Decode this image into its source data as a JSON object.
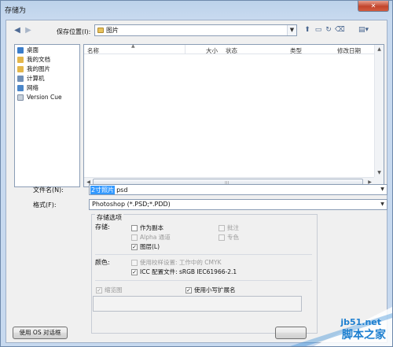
{
  "window": {
    "title": "存储为"
  },
  "toolbar": {
    "location_label": "保存位置(I):",
    "location_value": "图片"
  },
  "places": [
    {
      "label": "桌面",
      "icon": "desktop-icon",
      "color": "#3b7dc9"
    },
    {
      "label": "我的文档",
      "icon": "documents-icon",
      "color": "#e3b64a"
    },
    {
      "label": "我的图片",
      "icon": "pictures-icon",
      "color": "#e3b64a"
    },
    {
      "label": "计算机",
      "icon": "computer-icon",
      "color": "#6f8fb7"
    },
    {
      "label": "网络",
      "icon": "network-icon",
      "color": "#4a86c9"
    },
    {
      "label": "Version Cue",
      "icon": "version-cue-icon",
      "color": "#c8d1db"
    }
  ],
  "filelist": {
    "columns": [
      "名称",
      "大小",
      "状态",
      "类型",
      "修改日期"
    ]
  },
  "form": {
    "filename_label": "文件名(N):",
    "filename_selected": "2寸照片",
    "filename_rest": "psd",
    "format_label": "格式(F):",
    "format_value": "Photoshop (*.PSD;*.PDD)"
  },
  "options": {
    "title": "存储选项",
    "save_label": "存储:",
    "as_copy": "作为副本",
    "notes": "批注",
    "alpha": "Alpha 通道",
    "spot": "专色",
    "layers": "图层(L)",
    "color_label": "颜色:",
    "use_proof": "使用校样设置: 工作中的 CMYK",
    "icc": "ICC 配置文件: sRGB IEC61966-2.1",
    "thumbnail": "缩览图",
    "lowercase_ext": "使用小写扩展名"
  },
  "buttons": {
    "os_dialog": "使用 OS 对话框"
  },
  "watermark": {
    "site": "jb51.net",
    "name": "脚本之家"
  }
}
